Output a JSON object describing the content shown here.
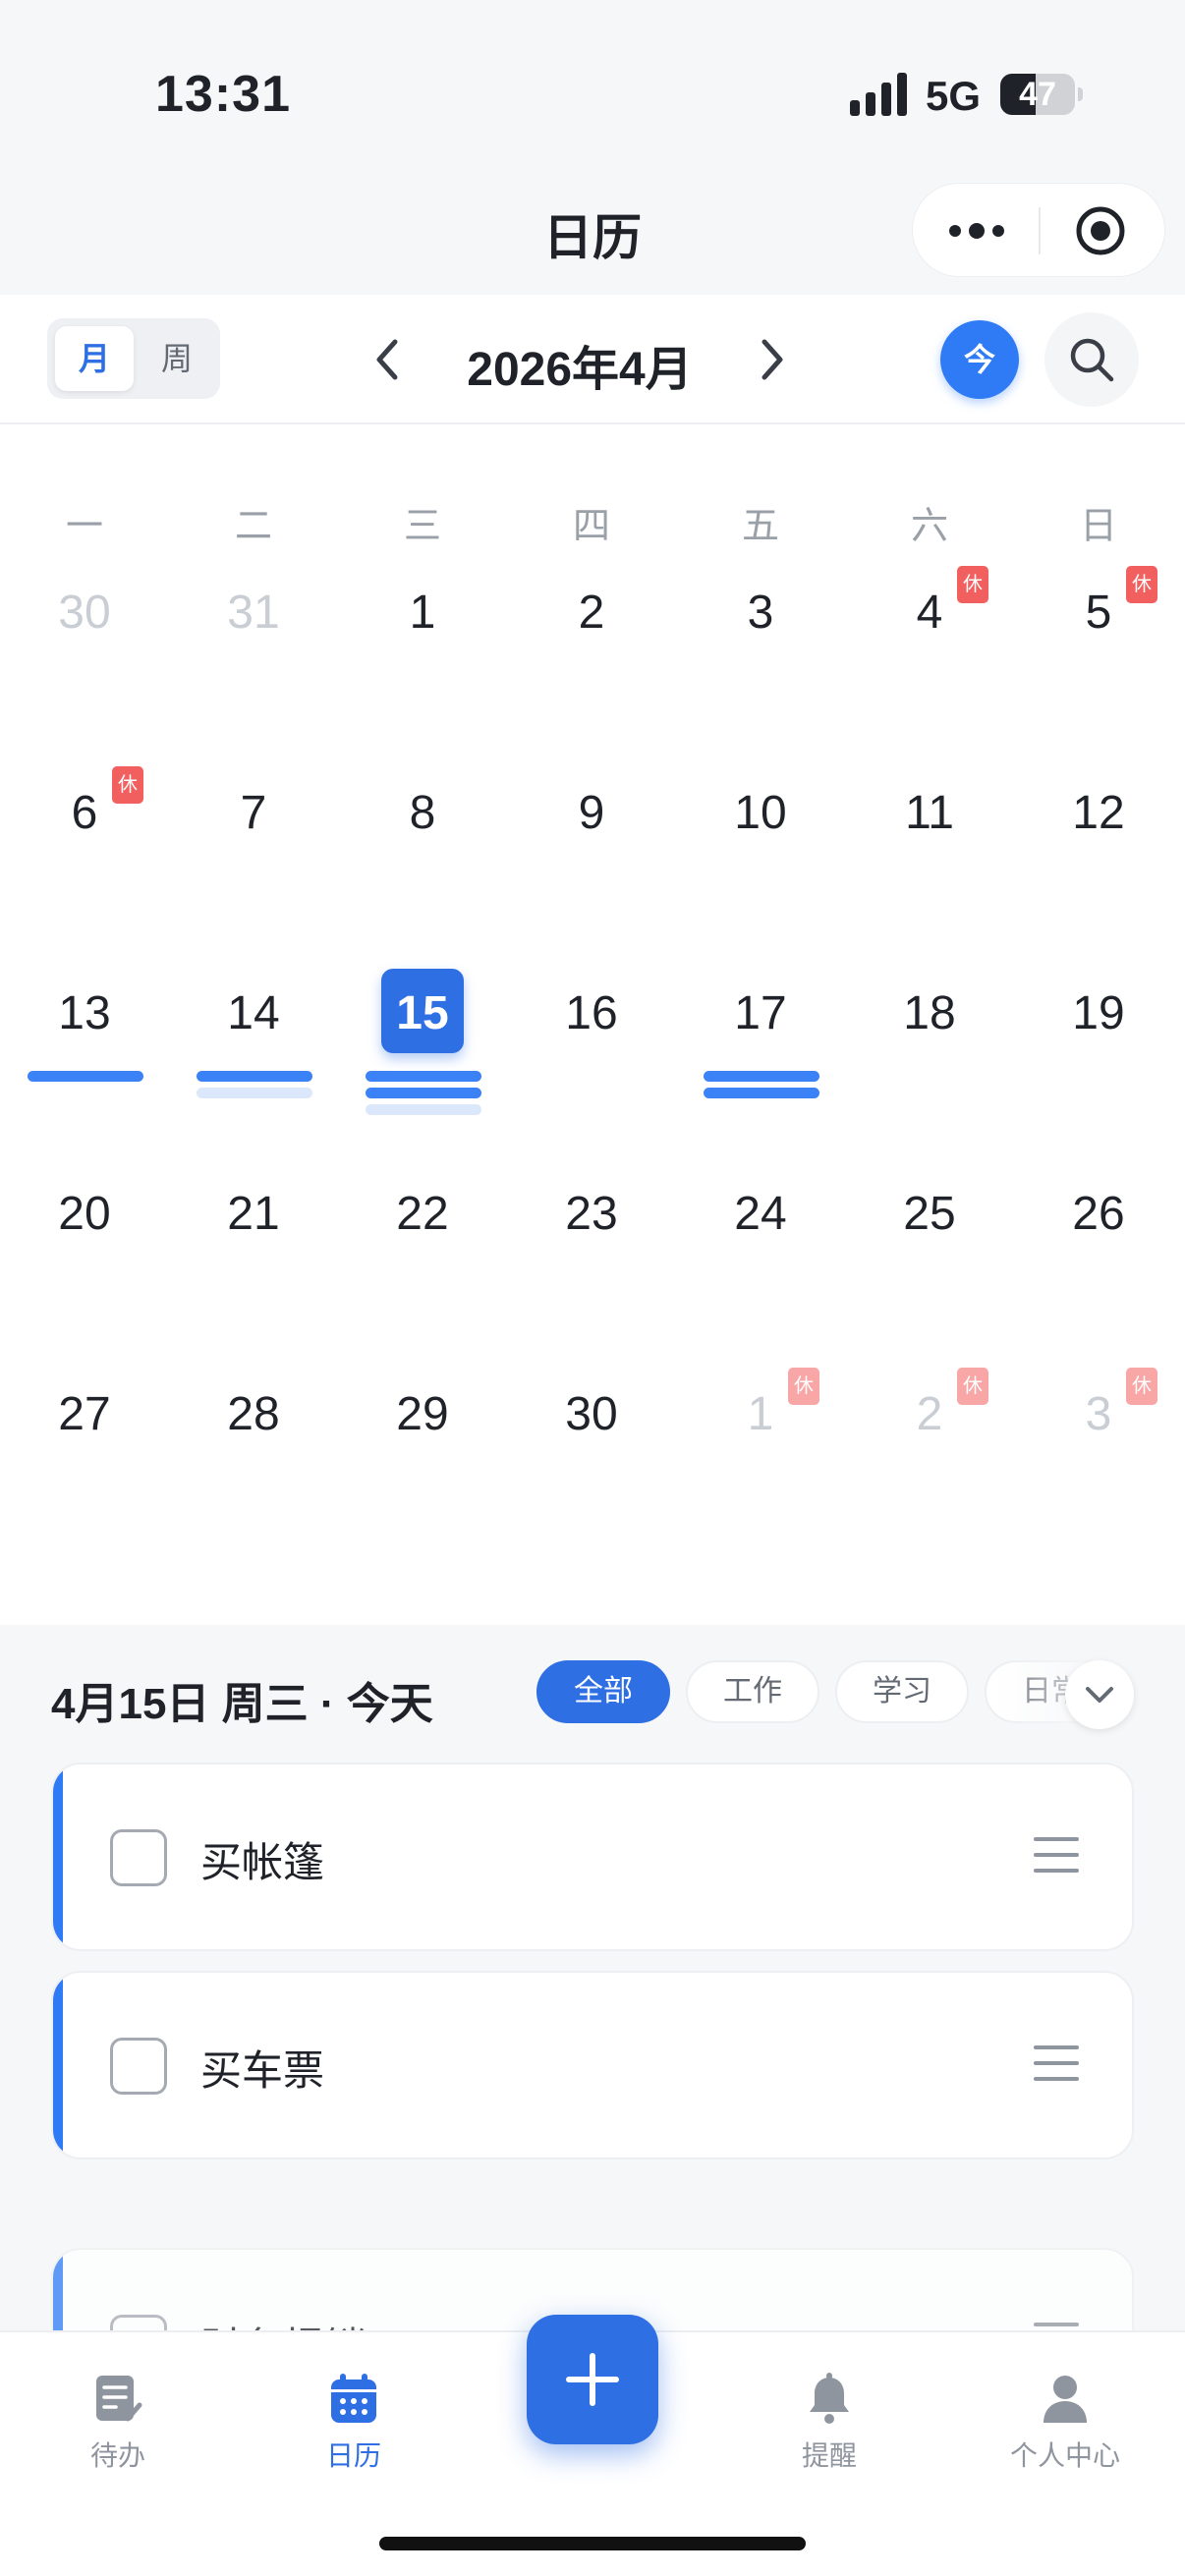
{
  "status_bar": {
    "time": "13:31",
    "network": "5G",
    "battery": "47",
    "battery_level": 0.47
  },
  "nav": {
    "title": "日历",
    "more_icon": "more-dots-icon",
    "close_icon": "target-circle-icon"
  },
  "toolbar": {
    "view_month": "月",
    "view_week": "周",
    "month_label": "2026年4月",
    "today_label": "今"
  },
  "calendar": {
    "weekdays": [
      "一",
      "二",
      "三",
      "四",
      "五",
      "六",
      "日"
    ],
    "rest_label": "休",
    "weeks": [
      [
        {
          "d": "30",
          "dim": true
        },
        {
          "d": "31",
          "dim": true
        },
        {
          "d": "1"
        },
        {
          "d": "2"
        },
        {
          "d": "3"
        },
        {
          "d": "4",
          "rest": true
        },
        {
          "d": "5",
          "rest": true
        }
      ],
      [
        {
          "d": "6",
          "rest": true
        },
        {
          "d": "7"
        },
        {
          "d": "8"
        },
        {
          "d": "9"
        },
        {
          "d": "10"
        },
        {
          "d": "11"
        },
        {
          "d": "12"
        }
      ],
      [
        {
          "d": "13",
          "bars": [
            "dark"
          ]
        },
        {
          "d": "14",
          "bars": [
            "dark",
            "light"
          ]
        },
        {
          "d": "15",
          "selected": true,
          "bars": [
            "dark",
            "dark",
            "light"
          ]
        },
        {
          "d": "16"
        },
        {
          "d": "17",
          "bars": [
            "dark",
            "dark"
          ]
        },
        {
          "d": "18"
        },
        {
          "d": "19"
        }
      ],
      [
        {
          "d": "20"
        },
        {
          "d": "21"
        },
        {
          "d": "22"
        },
        {
          "d": "23"
        },
        {
          "d": "24"
        },
        {
          "d": "25"
        },
        {
          "d": "26"
        }
      ],
      [
        {
          "d": "27"
        },
        {
          "d": "28"
        },
        {
          "d": "29"
        },
        {
          "d": "30"
        },
        {
          "d": "1",
          "dim": true,
          "rest": true
        },
        {
          "d": "2",
          "dim": true,
          "rest": true
        },
        {
          "d": "3",
          "dim": true,
          "rest": true
        }
      ]
    ]
  },
  "day_panel": {
    "title": "4月15日 周三 · 今天",
    "filters": [
      "全部",
      "工作",
      "学习",
      "日常"
    ],
    "active_filter": "全部"
  },
  "tasks": [
    {
      "title": "买帐篷",
      "done": false
    },
    {
      "title": "买车票",
      "done": false
    },
    {
      "title": "财务报销",
      "done": false
    }
  ],
  "tabbar": {
    "items": [
      {
        "label": "待办",
        "icon": "todo-list-icon",
        "active": false
      },
      {
        "label": "日历",
        "icon": "calendar-icon",
        "active": true
      },
      {
        "label": "提醒",
        "icon": "bell-icon",
        "active": false
      },
      {
        "label": "个人中心",
        "icon": "person-icon",
        "active": false
      }
    ],
    "add_icon": "plus-icon"
  },
  "colors": {
    "accent": "#2f6fe4",
    "rest_badge": "#f25f5f",
    "event_bar": "#3b82f6",
    "event_bar_light": "#dbe8fb"
  }
}
